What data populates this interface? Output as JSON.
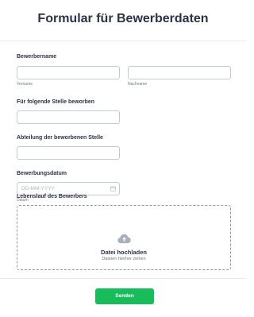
{
  "form": {
    "title": "Formular für Bewerberdaten"
  },
  "fields": {
    "applicant_name": {
      "label": "Bewerbername",
      "first_sublabel": "Vorname",
      "last_sublabel": "Nachname",
      "first_value": "",
      "last_value": ""
    },
    "position": {
      "label": "Für folgende Stelle beworben",
      "value": ""
    },
    "department": {
      "label": "Abteilung der beworbenen Stelle",
      "value": ""
    },
    "date": {
      "label": "Bewerbungsdatum",
      "placeholder": "DD-MM-YYYY",
      "sublabel": "Datum",
      "icon": "calendar-icon"
    },
    "resume": {
      "label": "Lebenslauf des Bewerbers",
      "upload_title": "Datei hochladen",
      "upload_hint": "Dateien hierher ziehen",
      "icon": "cloud-upload-icon"
    }
  },
  "actions": {
    "submit_label": "Senden"
  },
  "colors": {
    "accent": "#18bd5b",
    "text": "#2c3345",
    "border": "#c3cad8"
  }
}
